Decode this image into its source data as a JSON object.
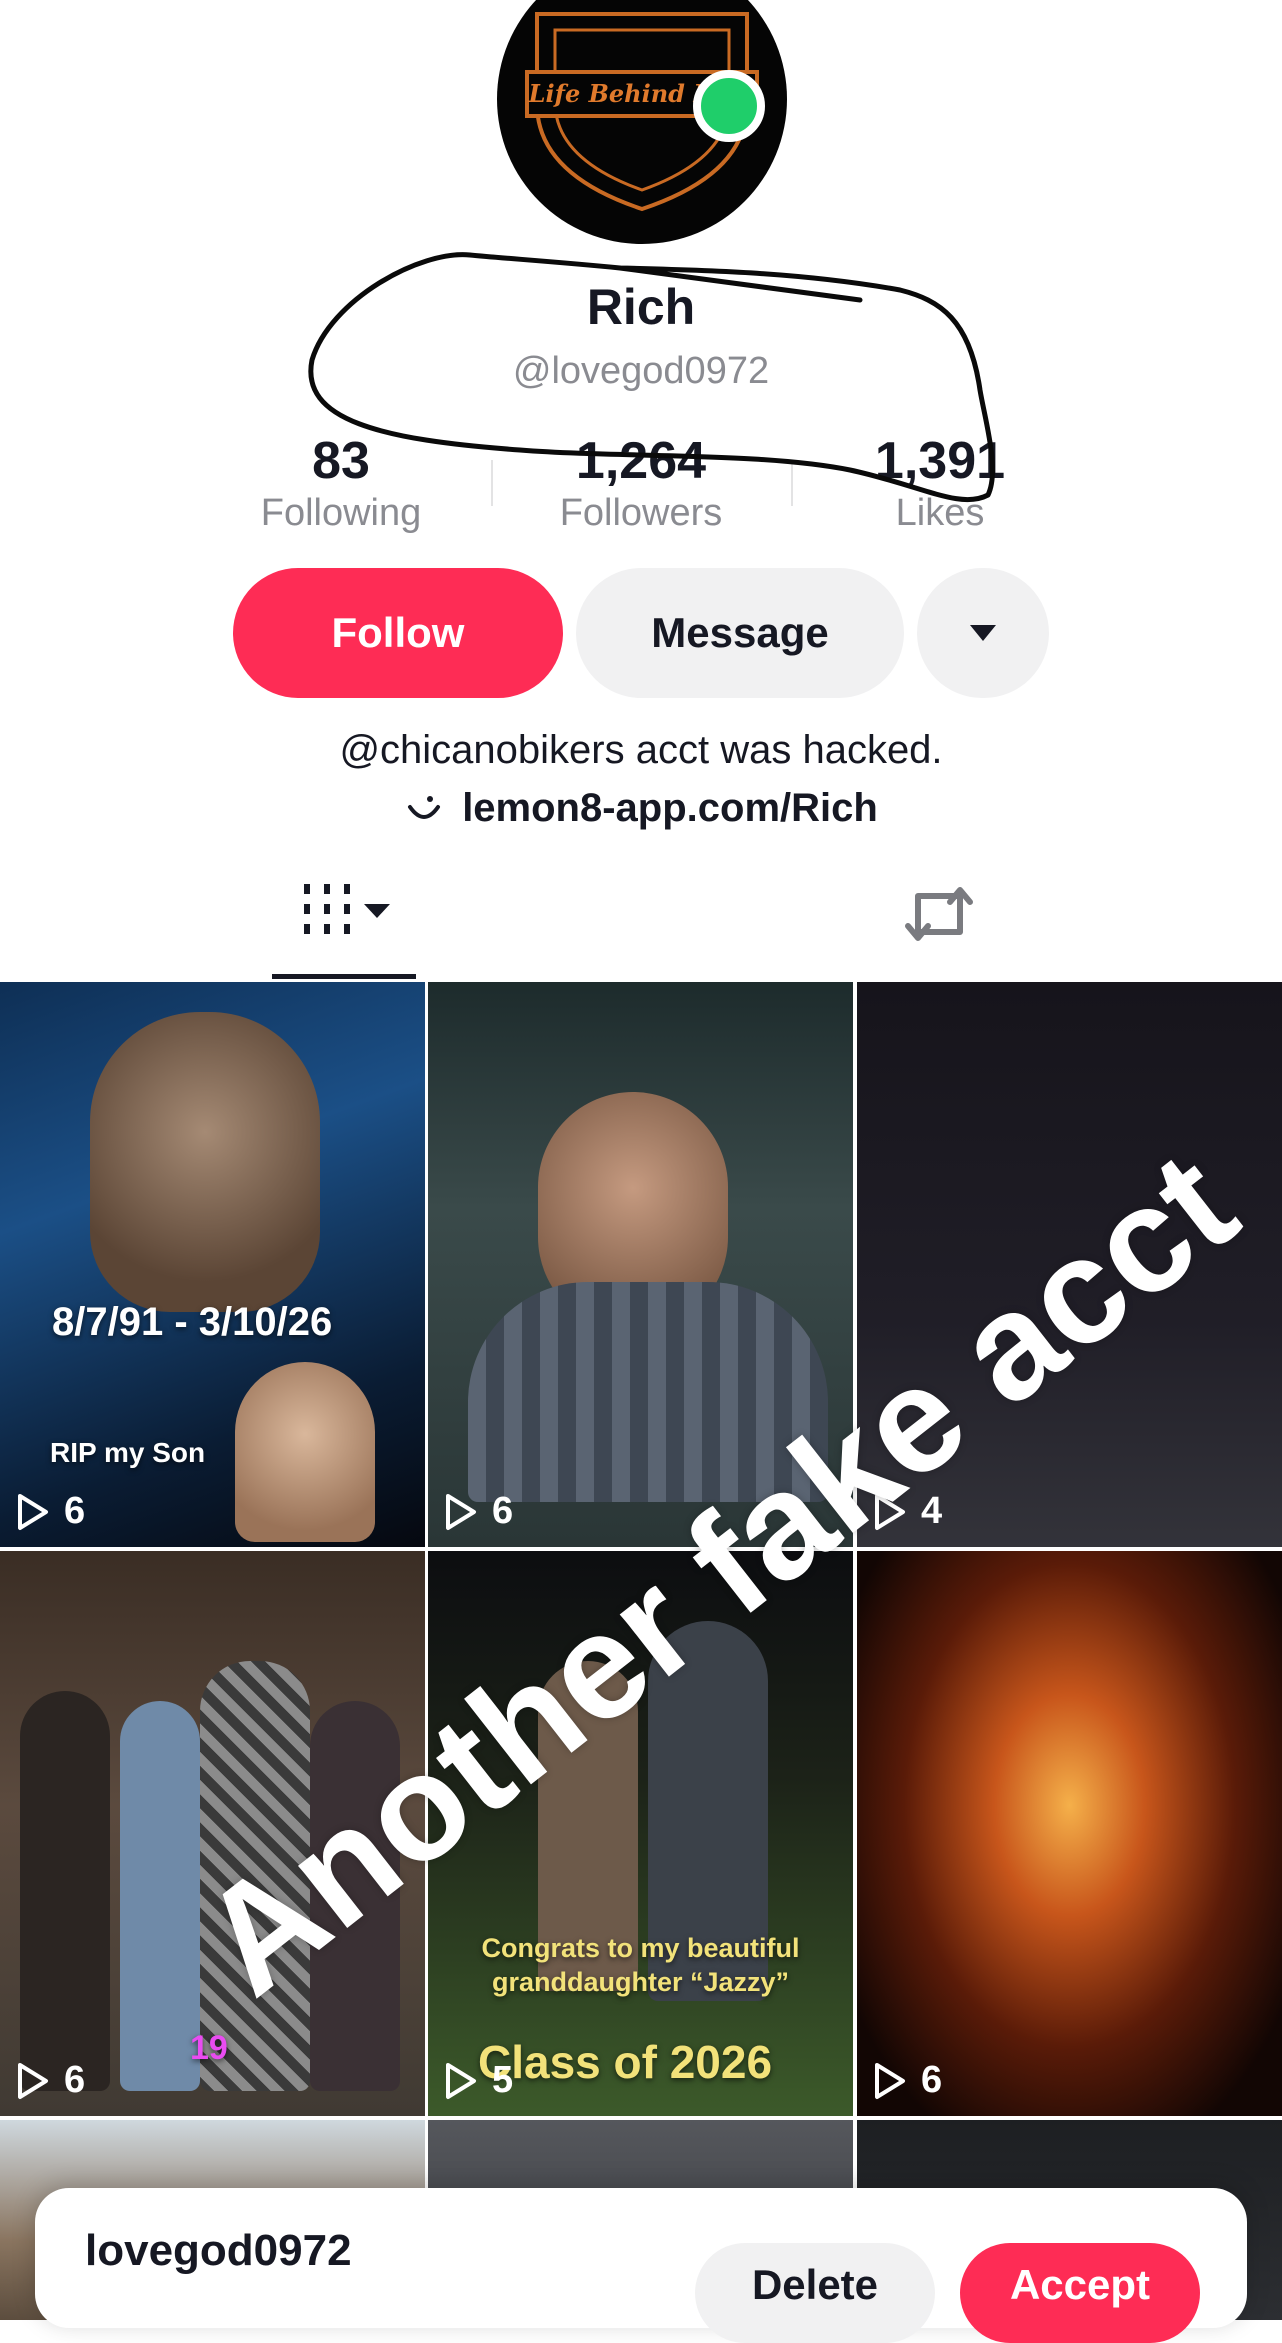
{
  "profile": {
    "avatar_text": "Life Behind Bars",
    "display_name": "Rich",
    "handle": "@lovegod0972",
    "stats": [
      {
        "value": "83",
        "label": "Following"
      },
      {
        "value": "1,264",
        "label": "Followers"
      },
      {
        "value": "1,391",
        "label": "Likes"
      }
    ],
    "bio": "@chicanobikers acct was hacked.",
    "link": "lemon8-app.com/Rich"
  },
  "actions": {
    "follow": "Follow",
    "message": "Message"
  },
  "videos": [
    {
      "plays": "6",
      "caption": "8/7/91 - 3/10/26",
      "sub_caption": "RIP my Son"
    },
    {
      "plays": "6"
    },
    {
      "plays": "4"
    },
    {
      "plays": "6",
      "sticker": "19"
    },
    {
      "plays": "5",
      "caption": "Congrats to my beautiful granddaughter “Jazzy”",
      "sub_caption": "Class of 2026"
    },
    {
      "plays": "6"
    }
  ],
  "annotation": {
    "watermark": "Another fake acct"
  },
  "request": {
    "username": "lovegod0972",
    "delete": "Delete",
    "accept": "Accept"
  },
  "colors": {
    "accent": "#fe2c55",
    "online": "#1fce6a",
    "secondary_text": "#8a8b91"
  }
}
